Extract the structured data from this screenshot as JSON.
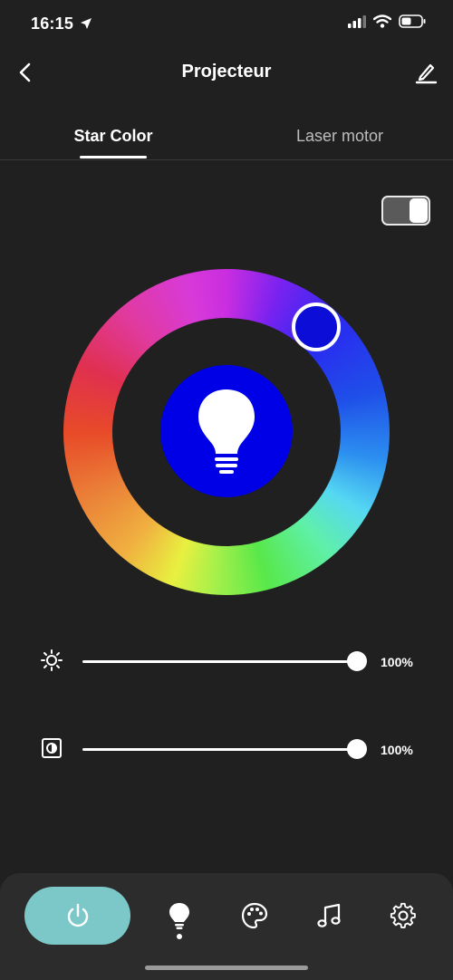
{
  "status_bar": {
    "time": "16:15"
  },
  "header": {
    "title": "Projecteur"
  },
  "tabs": [
    {
      "label": "Star Color",
      "active": true
    },
    {
      "label": "Laser motor",
      "active": false
    }
  ],
  "toggle": {
    "state": "on"
  },
  "color_wheel": {
    "selected_color": "#0d0dd8"
  },
  "sliders": {
    "brightness": {
      "value_text": "100%",
      "value": 1.0
    },
    "saturation": {
      "value_text": "100%",
      "value": 1.0
    }
  },
  "bottom_nav": {
    "items": [
      "power-icon",
      "bulb-icon",
      "palette-icon",
      "music-icon",
      "gear-icon"
    ],
    "active": "bulb-icon",
    "power_color": "#7cc8c8"
  }
}
